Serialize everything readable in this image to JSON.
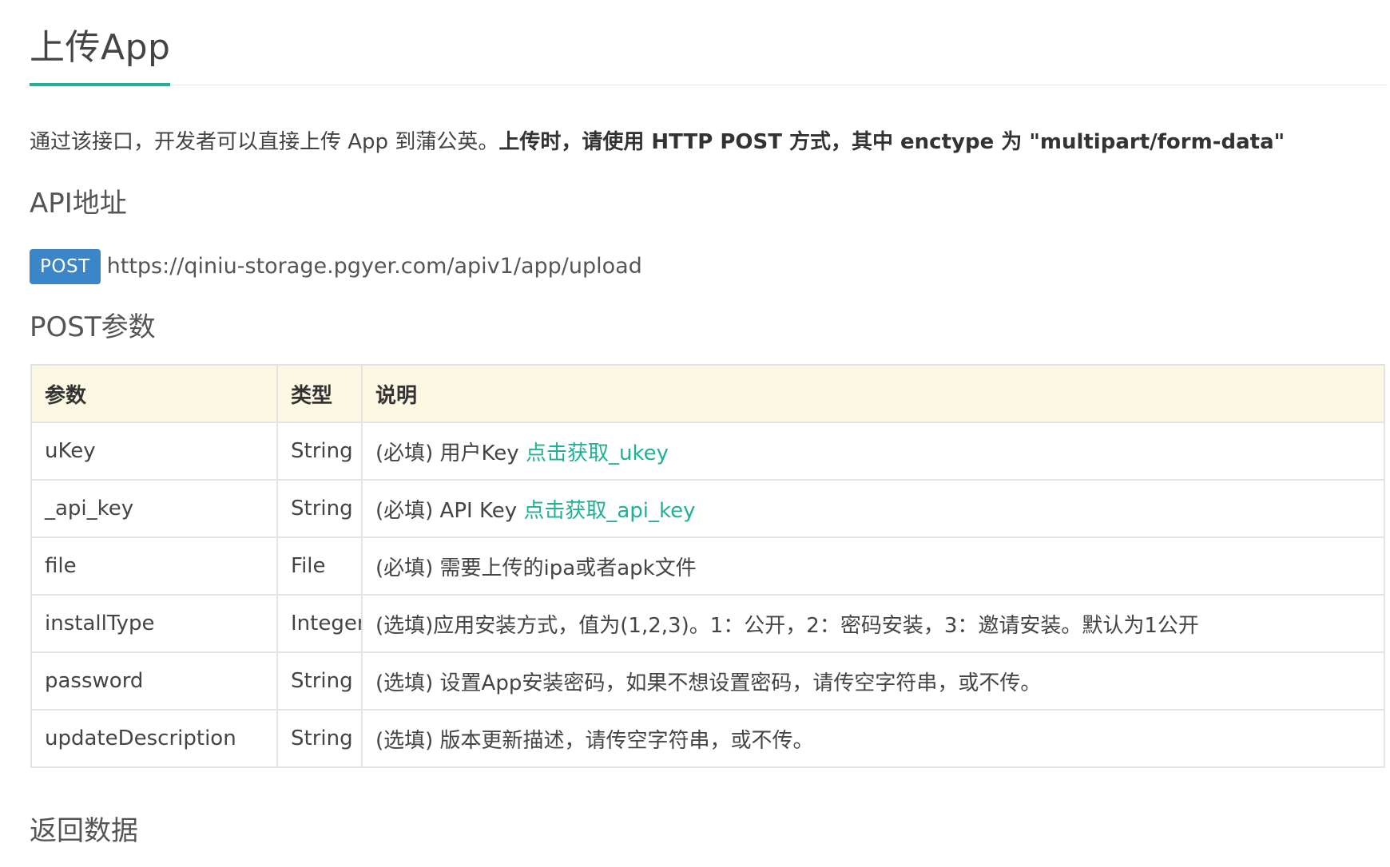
{
  "page": {
    "title": "上传App"
  },
  "intro": {
    "text": "通过该接口，开发者可以直接上传 App 到蒲公英。",
    "emphasis": "上传时，请使用 HTTP POST 方式，其中 enctype 为 \"multipart/form-data\""
  },
  "sections": {
    "api_address": "API地址",
    "post_params": "POST参数",
    "return_data": "返回数据"
  },
  "api": {
    "method": "POST",
    "url": "https://qiniu-storage.pgyer.com/apiv1/app/upload"
  },
  "params_table": {
    "headers": [
      "参数",
      "类型",
      "说明"
    ],
    "rows": [
      {
        "param": "uKey",
        "type": "String",
        "desc": "(必填) 用户Key ",
        "link": "点击获取_ukey"
      },
      {
        "param": "_api_key",
        "type": "String",
        "desc": "(必填) API Key ",
        "link": "点击获取_api_key"
      },
      {
        "param": "file",
        "type": "File",
        "desc": "(必填) 需要上传的ipa或者apk文件",
        "link": ""
      },
      {
        "param": "installType",
        "type": "Integer",
        "desc": "(选填)应用安装方式，值为(1,2,3)。1：公开，2：密码安装，3：邀请安装。默认为1公开",
        "link": ""
      },
      {
        "param": "password",
        "type": "String",
        "desc": "(选填) 设置App安装密码，如果不想设置密码，请传空字符串，或不传。",
        "link": ""
      },
      {
        "param": "updateDescription",
        "type": "String",
        "desc": "(选填) 版本更新描述，请传空字符串，或不传。",
        "link": ""
      }
    ]
  },
  "colors": {
    "accent": "#1fb096",
    "badge": "#3a86c8",
    "table_header_bg": "#fcf8e3",
    "border": "#e3e3e3"
  }
}
